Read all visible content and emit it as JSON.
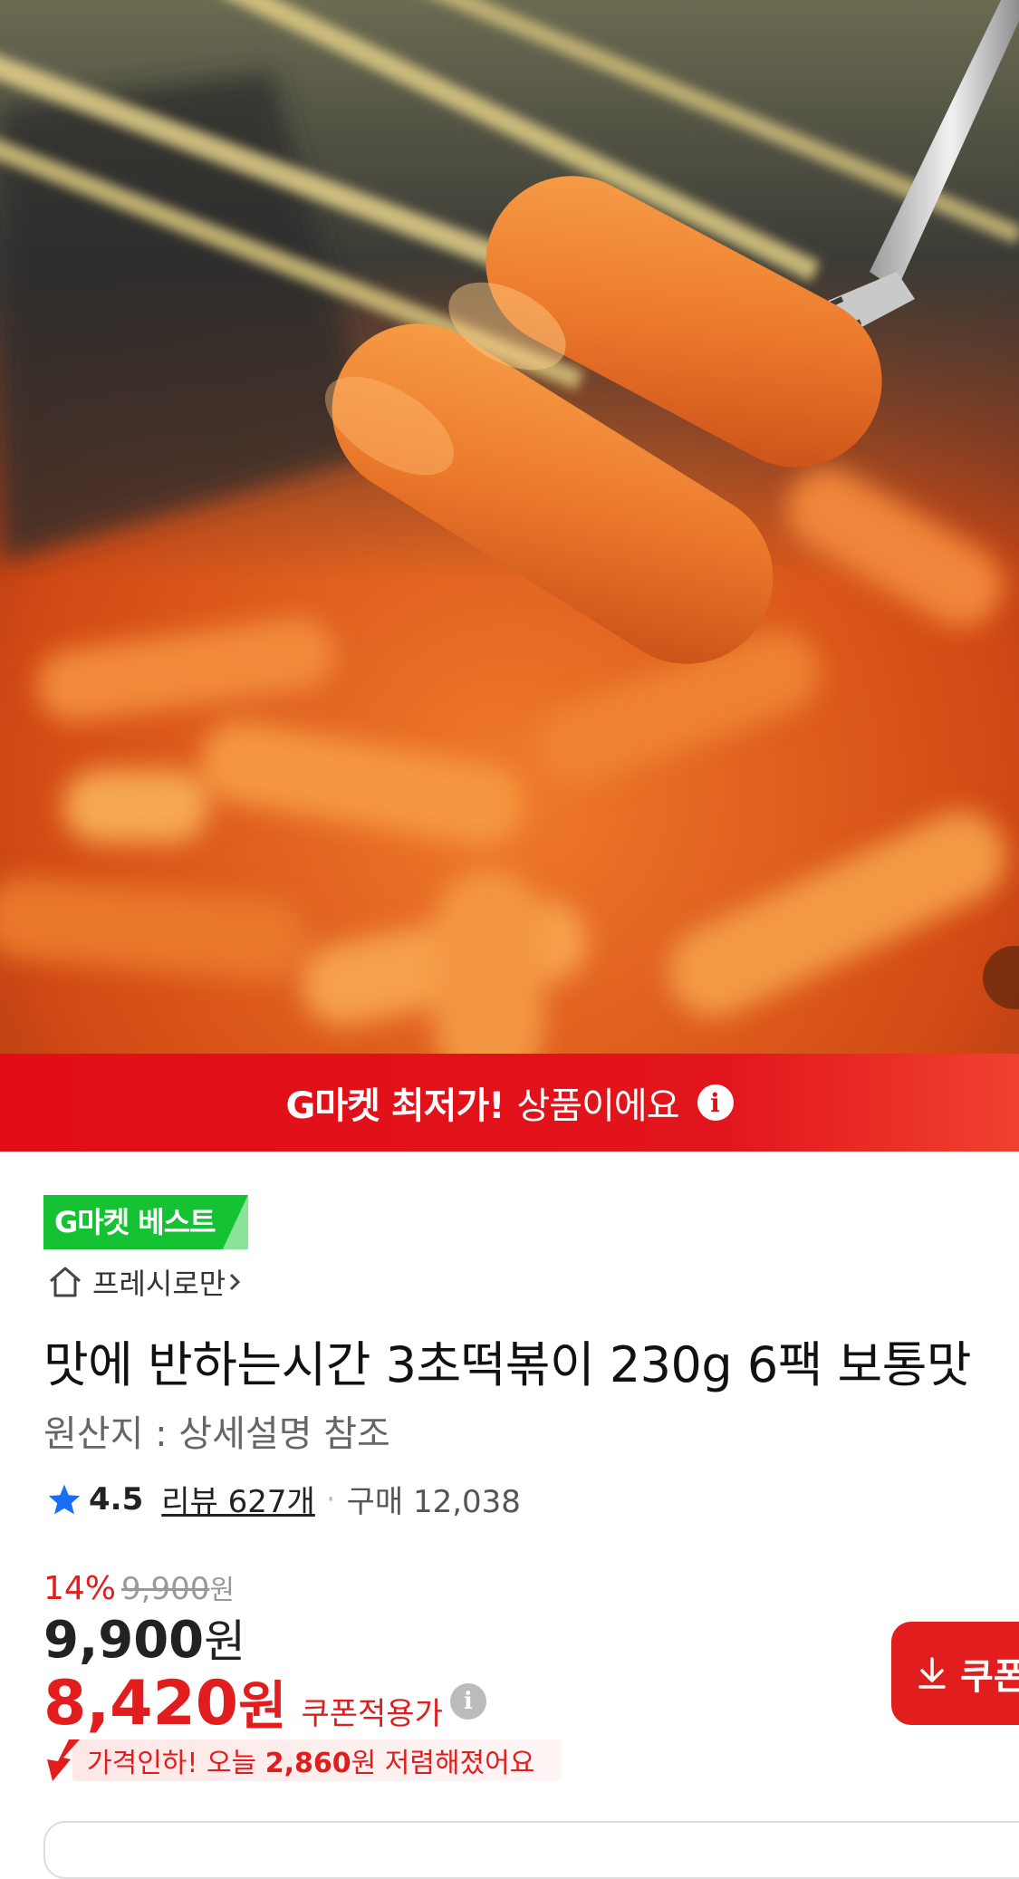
{
  "banner": {
    "strong": "G마켓 최저가!",
    "rest": "상품이에요"
  },
  "badge": {
    "best": "G마켓 베스트"
  },
  "shop": {
    "name": "프레시로만"
  },
  "product": {
    "title": "맛에 반하는시간 3초떡볶이 230g 6팩 보통맛",
    "origin": "원산지 : 상세설명 참조"
  },
  "rating": {
    "score": "4.5",
    "reviews": "리뷰 627개",
    "separator": "·",
    "purchases": "구매 12,038"
  },
  "price": {
    "discount_pct": "14%",
    "original": "9,900",
    "original_unit": "원",
    "current": "9,900",
    "current_unit": "원",
    "coupon_price": "8,420",
    "coupon_unit": "원",
    "coupon_label": "쿠폰적용가"
  },
  "coupon_button": {
    "label": "쿠폰"
  },
  "price_drop": {
    "prefix": "가격인하! 오늘 ",
    "amount": "2,860",
    "suffix": "원 저렴해졌어요"
  },
  "colors": {
    "accent_red": "#e11d1d",
    "best_green": "#15c234"
  },
  "icons": [
    "info-icon",
    "home-icon",
    "chevron-right-icon",
    "star-icon",
    "download-icon",
    "price-down-arrow-icon"
  ]
}
